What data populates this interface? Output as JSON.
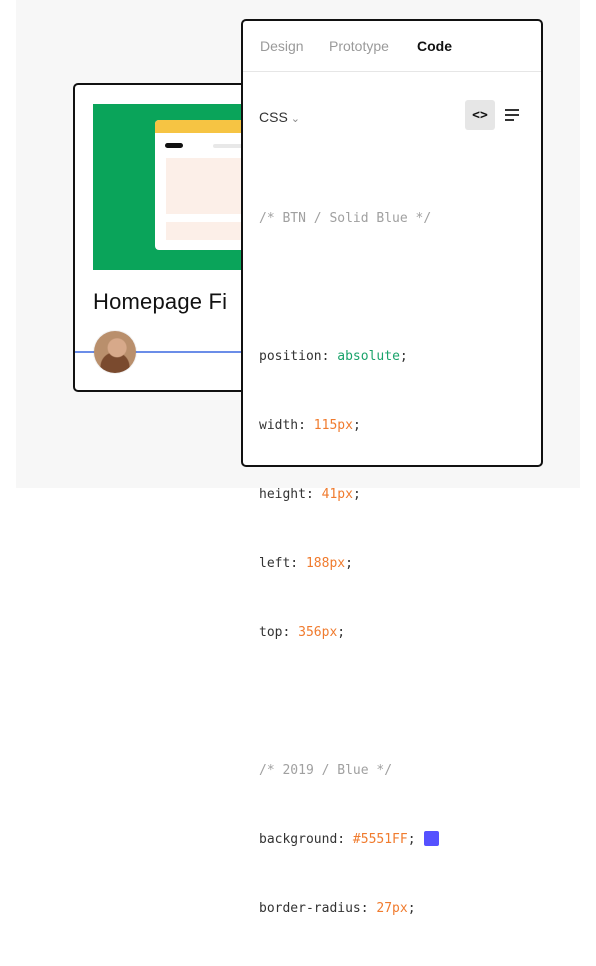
{
  "colors": {
    "thumb_green": "#0aa45a",
    "swatch_blue": "#5551FF",
    "keyword_green": "#1aa36b",
    "number_orange": "#f07b2e"
  },
  "file_card": {
    "title": "Homepage Fi"
  },
  "inspect": {
    "tabs": [
      {
        "label": "Design"
      },
      {
        "label": "Prototype"
      },
      {
        "label": "Code"
      }
    ],
    "language": "CSS",
    "view_toggle_icon": "code-brackets-icon",
    "menu_icon": "list-icon",
    "code": {
      "comment1": "/* BTN / Solid Blue */",
      "lines": [
        {
          "prop": "position: ",
          "value": "absolute",
          "type": "kw"
        },
        {
          "prop": "width: ",
          "value": "115px",
          "type": "num"
        },
        {
          "prop": "height: ",
          "value": "41px",
          "type": "num"
        },
        {
          "prop": "left: ",
          "value": "188px",
          "type": "num"
        },
        {
          "prop": "top: ",
          "value": "356px",
          "type": "num"
        }
      ],
      "comment2": "/* 2019 / Blue */",
      "background_prop": "background: ",
      "background_value": "#5551FF",
      "radius_prop": "border-radius: ",
      "radius_value": "27px"
    }
  }
}
